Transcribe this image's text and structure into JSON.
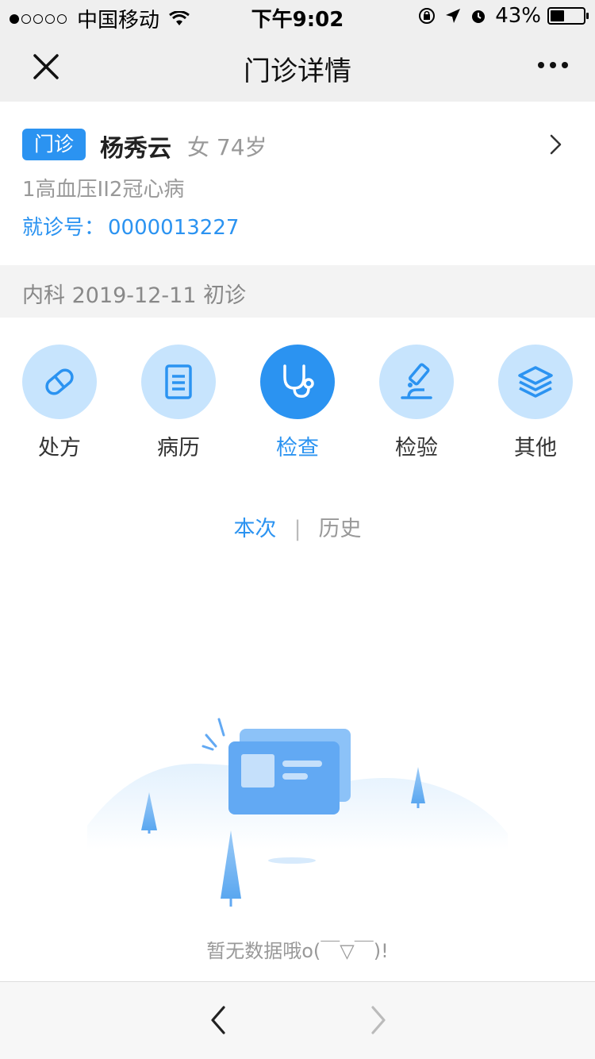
{
  "status_bar": {
    "carrier": "中国移动",
    "time": "下午9:02",
    "battery": "43%",
    "battery_level": 0.43
  },
  "nav": {
    "title": "门诊详情"
  },
  "patient": {
    "badge": "门诊",
    "name": "杨秀云",
    "meta": "女 74岁",
    "diagnosis": "1高血压II2冠心病",
    "visit_label": "就诊号：",
    "visit_no": "0000013227"
  },
  "dept_bar": {
    "text": "内科 2019-12-11 初诊"
  },
  "categories": [
    {
      "label": "处方",
      "icon": "pill-icon",
      "active": false
    },
    {
      "label": "病历",
      "icon": "document-icon",
      "active": false
    },
    {
      "label": "检查",
      "icon": "stethoscope-icon",
      "active": true
    },
    {
      "label": "检验",
      "icon": "microscope-icon",
      "active": false
    },
    {
      "label": "其他",
      "icon": "layers-icon",
      "active": false
    }
  ],
  "tabs": {
    "current": "本次",
    "separator": "|",
    "history": "历史"
  },
  "empty": {
    "message": "暂无数据哦o(￣▽￣)!"
  },
  "colors": {
    "accent": "#2b93f1",
    "icon_bg": "#c7e4fd"
  }
}
